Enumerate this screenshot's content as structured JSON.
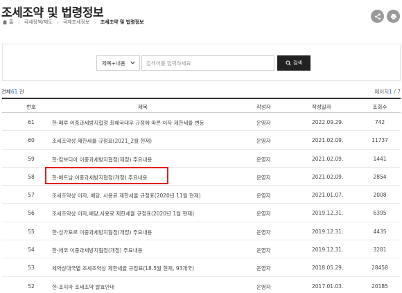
{
  "header": {
    "title": "조세조약 및 법령정보",
    "breadcrumb": [
      "홈",
      "국세정책/제도",
      "국제조세정보",
      "조세조약 및 법령정보"
    ]
  },
  "search": {
    "select_value": "제목+내용",
    "placeholder": "검색어를 입력하세요",
    "button_label": "검색"
  },
  "summary": {
    "prefix": "전체",
    "count": "61",
    "suffix": "건",
    "page_label": "페이지",
    "page_current": "1",
    "page_sep": " / ",
    "page_total": "7"
  },
  "table": {
    "headers": [
      "번호",
      "제목",
      "작성자",
      "작성일자",
      "조회수"
    ],
    "rows": [
      {
        "no": "61",
        "title": "한-페루 이중과세방지협정 최혜국대우 규정에 따른 이자 제한세율 변동",
        "writer": "운영자",
        "date": "2022.09.29.",
        "views": "742"
      },
      {
        "no": "60",
        "title": "조세조약상 제한세율 규정표(2021_2월 현재)",
        "writer": "운영자",
        "date": "2021.02.09.",
        "views": "11737"
      },
      {
        "no": "59",
        "title": "한-캄보디아 이중과세방지협정(제정) 주요내용",
        "writer": "운영자",
        "date": "2021.02.09.",
        "views": "1441"
      },
      {
        "no": "58",
        "title": "한-베트남 이중과세방지협정(개정) 주요내용",
        "writer": "운영자",
        "date": "2021.02.09.",
        "views": "2854"
      },
      {
        "no": "57",
        "title": "조세조약상 이자, 배당, 사용료 제한세율 규정표(2020년 11월 현재)",
        "writer": "운영자",
        "date": "2021.01.07.",
        "views": "2008"
      },
      {
        "no": "56",
        "title": "조세조약상 이자,배당,사용료 제한세율 규정표(2020년 1월 현재)",
        "writer": "운영자",
        "date": "2019.12.31.",
        "views": "6395"
      },
      {
        "no": "55",
        "title": "한-싱가포르 이중과세방지협정(개정) 주요내용",
        "writer": "운영자",
        "date": "2019.12.31.",
        "views": "4435"
      },
      {
        "no": "54",
        "title": "한-체코 이중과세방지협정(개정) 주요내용",
        "writer": "운영자",
        "date": "2019.12.31.",
        "views": "3281"
      },
      {
        "no": "53",
        "title": "체약상대국별 조세조약상 제한세율 규정표(18.5월 현재, 93개국)",
        "writer": "운영자",
        "date": "2018.05.29.",
        "views": "28458"
      },
      {
        "no": "52",
        "title": "한-조지아 조세조약 발효안내",
        "writer": "운영자",
        "date": "2017.01.03.",
        "views": "20185"
      }
    ]
  },
  "colors": {
    "accent": "#1a6fc9",
    "highlight": "#e01e1e",
    "button": "#222222",
    "icon_circle": "#9a9a9a"
  }
}
